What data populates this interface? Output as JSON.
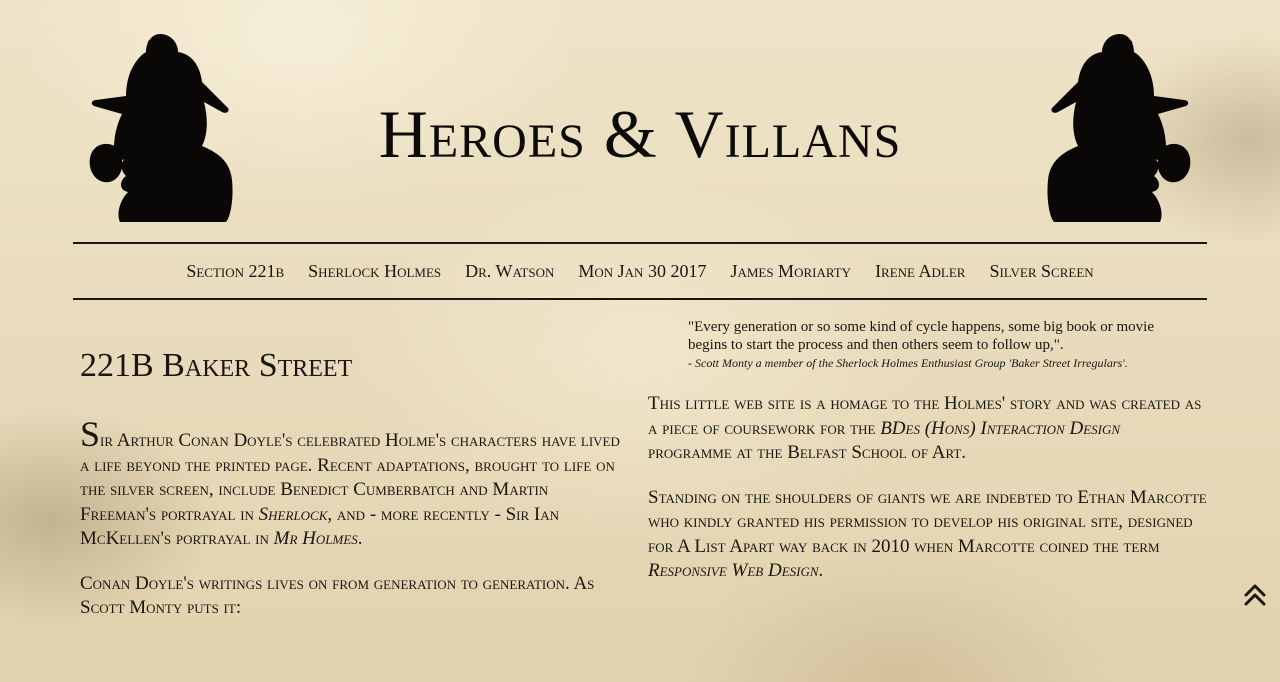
{
  "site": {
    "title": "Heroes & Villans"
  },
  "nav": {
    "items": [
      {
        "label": "Section 221b"
      },
      {
        "label": "Sherlock Holmes"
      },
      {
        "label": "Dr. Watson"
      },
      {
        "label": "Mon Jan 30 2017"
      },
      {
        "label": "James Moriarty"
      },
      {
        "label": "Irene Adler"
      },
      {
        "label": "Silver Screen"
      }
    ]
  },
  "main": {
    "heading": "221B Baker Street",
    "intro": {
      "dropcap": "S",
      "text1": "ir Arthur Conan Doyle's celebrated Holme's characters have lived a life beyond the printed page. Recent adaptations, brought to life on the silver screen, include Benedict Cumberbatch and Martin Freeman's portrayal in ",
      "em1": "Sherlock",
      "text2": ", and - more recently - Sir Ian McKellen's portrayal in ",
      "em2": "Mr Holmes",
      "text3": "."
    },
    "para2": "Conan Doyle's writings lives on from generation to generation. As Scott Monty puts it:"
  },
  "aside": {
    "quote": "\"Every generation or so some kind of cycle happens, some big book or movie begins to start the process and then others seem to follow up,\".",
    "cite": "- Scott Monty a member of the Sherlock Holmes Enthusiast Group 'Baker Street Irregulars'.",
    "para1": {
      "text1": "This little web site is a homage to the Holmes' story and was created as a piece of coursework for the ",
      "em": "BDes (Hons) Interaction Design",
      "text2": " programme at the Belfast School of Art."
    },
    "para2": {
      "text1": "Standing on the shoulders of giants we are indebted to Ethan Marcotte who kindly granted his permission to develop his original site, designed for A List Apart way back in 2010 when Marcotte coined the term ",
      "em": "Responsive Web Design",
      "text2": "."
    }
  },
  "icons": {
    "back_to_top": "double-chevron-up-icon",
    "silhouette": "sherlock-silhouette-icon"
  },
  "colors": {
    "paper": "#e9dcbd",
    "ink": "#1a1611"
  }
}
